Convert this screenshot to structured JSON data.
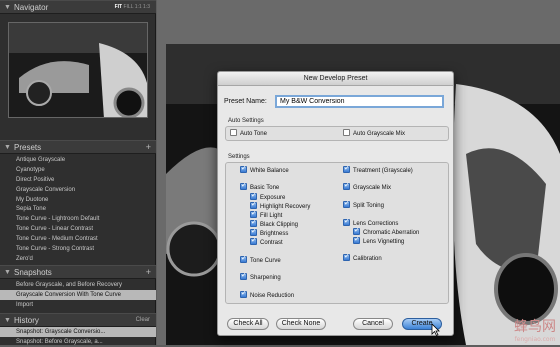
{
  "navigator": {
    "title": "Navigator",
    "zoom": [
      "FIT",
      "FILL",
      "1:1",
      "1:3"
    ]
  },
  "presets": {
    "title": "Presets",
    "add": "+",
    "items": [
      {
        "label": "Antique Grayscale",
        "selected": false
      },
      {
        "label": "Cyanotype",
        "selected": false
      },
      {
        "label": "Direct Positive",
        "selected": false
      },
      {
        "label": "Grayscale Conversion",
        "selected": false
      },
      {
        "label": "My Duotone",
        "selected": false
      },
      {
        "label": "Sepia Tone",
        "selected": false
      },
      {
        "label": "Tone Curve - Lightroom Default",
        "selected": false
      },
      {
        "label": "Tone Curve - Linear Contrast",
        "selected": false
      },
      {
        "label": "Tone Curve - Medium Contrast",
        "selected": false
      },
      {
        "label": "Tone Curve - Strong Contrast",
        "selected": false
      },
      {
        "label": "Zero'd",
        "selected": false
      }
    ]
  },
  "snapshots": {
    "title": "Snapshots",
    "add": "+",
    "items": [
      {
        "label": "Before Grayscale, and Before Recovery",
        "selected": false
      },
      {
        "label": "Grayscale Conversion With Tone Curve",
        "selected": true
      },
      {
        "label": "Import",
        "selected": false
      }
    ]
  },
  "history": {
    "title": "History",
    "clear": "Clear",
    "items": [
      {
        "label": "Snapshot: Grayscale Conversio...",
        "selected": true
      },
      {
        "label": "Snapshot: Before Grayscale, a...",
        "selected": false
      }
    ]
  },
  "dialog": {
    "title": "New Develop Preset",
    "preset_name_label": "Preset Name:",
    "preset_name_value": "My B&W Conversion",
    "auto_settings_label": "Auto Settings",
    "settings_label": "Settings",
    "auto": {
      "auto_tone": {
        "label": "Auto Tone",
        "checked": false
      },
      "auto_grayscale_mix": {
        "label": "Auto Grayscale Mix",
        "checked": false
      }
    },
    "settings": {
      "white_balance": {
        "label": "White Balance",
        "checked": true
      },
      "basic_tone": {
        "label": "Basic Tone",
        "checked": true
      },
      "exposure": {
        "label": "Exposure",
        "checked": true
      },
      "highlight_recovery": {
        "label": "Highlight Recovery",
        "checked": true
      },
      "fill_light": {
        "label": "Fill Light",
        "checked": true
      },
      "black_clipping": {
        "label": "Black Clipping",
        "checked": true
      },
      "brightness": {
        "label": "Brightness",
        "checked": true
      },
      "contrast": {
        "label": "Contrast",
        "checked": true
      },
      "tone_curve": {
        "label": "Tone Curve",
        "checked": true
      },
      "sharpening": {
        "label": "Sharpening",
        "checked": true
      },
      "noise_reduction": {
        "label": "Noise Reduction",
        "checked": true
      },
      "treatment": {
        "label": "Treatment (Grayscale)",
        "checked": true
      },
      "grayscale_mix": {
        "label": "Grayscale Mix",
        "checked": true
      },
      "split_toning": {
        "label": "Split Toning",
        "checked": true
      },
      "lens_corrections": {
        "label": "Lens Corrections",
        "checked": true
      },
      "chromatic_aberration": {
        "label": "Chromatic Aberration",
        "checked": true
      },
      "lens_vignetting": {
        "label": "Lens Vignetting",
        "checked": true
      },
      "calibration": {
        "label": "Calibration",
        "checked": true
      }
    },
    "buttons": {
      "check_all": "Check All",
      "check_none": "Check None",
      "cancel": "Cancel",
      "create": "Create"
    }
  },
  "watermark": {
    "main": "蜂鸟网",
    "sub": "fengniao.com"
  },
  "colors": {
    "accent": "#3c82d6",
    "panel_bg": "#2f2f2f",
    "selection": "#b8b8b8"
  }
}
